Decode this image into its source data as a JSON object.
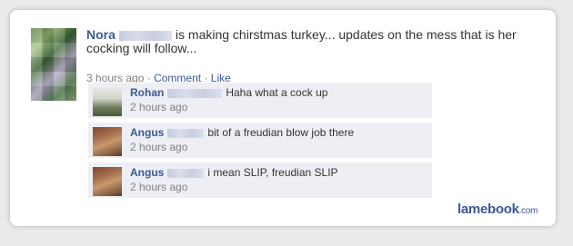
{
  "post": {
    "author": "Nora",
    "text": "is making chirstmas turkey... updates on the mess that is her cocking will follow...",
    "time": "3 hours ago",
    "sep1": "·",
    "comment_link": "Comment",
    "sep2": "·",
    "like_link": "Like"
  },
  "comments": [
    {
      "author": "Rohan",
      "text": "Haha what a cock up",
      "time": "2 hours ago"
    },
    {
      "author": "Angus",
      "text": "bit of a freudian blow job there",
      "time": "2 hours ago"
    },
    {
      "author": "Angus",
      "text": "i mean SLIP, freudian SLIP",
      "time": "2 hours ago"
    }
  ],
  "watermark": {
    "brand": "lamebook",
    "domain": ".com"
  },
  "colors": {
    "link_blue": "#3b5998",
    "comment_bg": "#edeff4",
    "meta_gray": "#808080"
  }
}
